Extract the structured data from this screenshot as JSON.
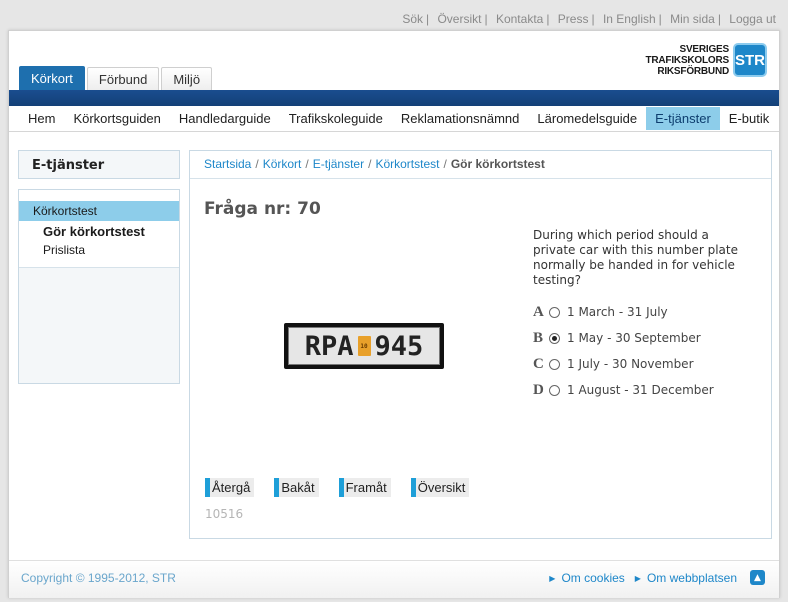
{
  "toplinks": [
    {
      "label": "Sök"
    },
    {
      "label": "Översikt"
    },
    {
      "label": "Kontakta"
    },
    {
      "label": "Press"
    },
    {
      "label": "In English"
    },
    {
      "label": "Min sida"
    },
    {
      "label": "Logga ut"
    }
  ],
  "logo": {
    "line1": "SVERIGES",
    "line2": "TRAFIKSKOLORS",
    "line3": "RIKSFÖRBUND",
    "mark": "STR"
  },
  "maintabs": [
    {
      "label": "Körkort",
      "active": true
    },
    {
      "label": "Förbund",
      "active": false
    },
    {
      "label": "Miljö",
      "active": false
    }
  ],
  "subnav": [
    {
      "label": "Hem"
    },
    {
      "label": "Körkortsguiden"
    },
    {
      "label": "Handledarguide"
    },
    {
      "label": "Trafikskoleguide"
    },
    {
      "label": "Reklamationsnämnd"
    },
    {
      "label": "Läromedelsguide"
    },
    {
      "label": "E-tjänster",
      "active": true
    },
    {
      "label": "E-butik"
    }
  ],
  "sidebar": {
    "title": "E-tjänster",
    "items": [
      {
        "label": "Körkortstest"
      },
      {
        "label": "Gör körkortstest"
      },
      {
        "label": "Prislista"
      }
    ]
  },
  "breadcrumb": {
    "links": [
      "Startsida",
      "Körkort",
      "E-tjänster",
      "Körkortstest"
    ],
    "current": "Gör körkortstest",
    "separator": "/"
  },
  "question": {
    "title": "Fråga nr: 70",
    "text": "During which period should a private car with this number plate normally be handed in for vehicle testing?",
    "plate": {
      "left": "RPA",
      "tag": "10",
      "right": "945"
    },
    "answers": [
      {
        "letter": "A",
        "text": "1 March - 31 July",
        "selected": false
      },
      {
        "letter": "B",
        "text": "1 May - 30 September",
        "selected": true
      },
      {
        "letter": "C",
        "text": "1 July - 30 November",
        "selected": false
      },
      {
        "letter": "D",
        "text": "1 August - 31 December",
        "selected": false
      }
    ],
    "id": "10516"
  },
  "buttons": {
    "back_to": "Återgå",
    "previous": "Bakåt",
    "next": "Framåt",
    "overview": "Översikt"
  },
  "footer": {
    "copyright": "Copyright © 1995-2012, STR",
    "links": [
      "Om cookies",
      "Om webbplatsen"
    ]
  },
  "colors": {
    "accent": "#1e87c9",
    "navbar": "#1a4d8f",
    "highlight": "#8dcdea"
  }
}
